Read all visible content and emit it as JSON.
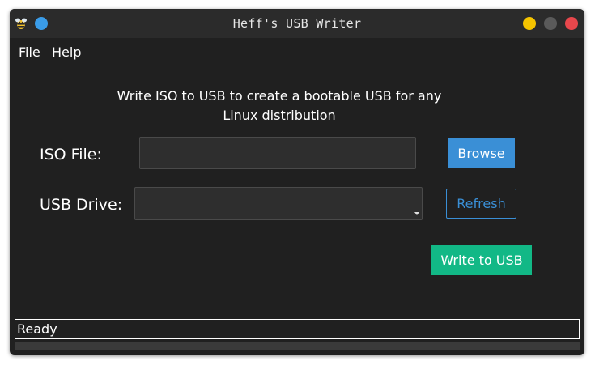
{
  "window": {
    "title": "Heff's USB Writer"
  },
  "menu": {
    "file_label": "File",
    "help_label": "Help"
  },
  "main": {
    "description_line1": "Write ISO to USB to create a bootable USB for any",
    "description_line2": "Linux distribution",
    "iso_label": "ISO File:",
    "iso_value": "",
    "usb_label": "USB Drive:",
    "usb_selected": "",
    "browse_label": "Browse",
    "refresh_label": "Refresh",
    "write_label": "Write to USB"
  },
  "status": {
    "text": "Ready"
  },
  "colors": {
    "accent_blue": "#3a8fd6",
    "accent_green": "#12b886",
    "background": "#202020",
    "minimize": "#f5c400",
    "maximize": "#5a5a5a",
    "close": "#e8474c"
  },
  "icons": {
    "app": "bee-icon",
    "sticky": "sticky-dot-icon",
    "dropdown": "chevron-down-icon"
  }
}
